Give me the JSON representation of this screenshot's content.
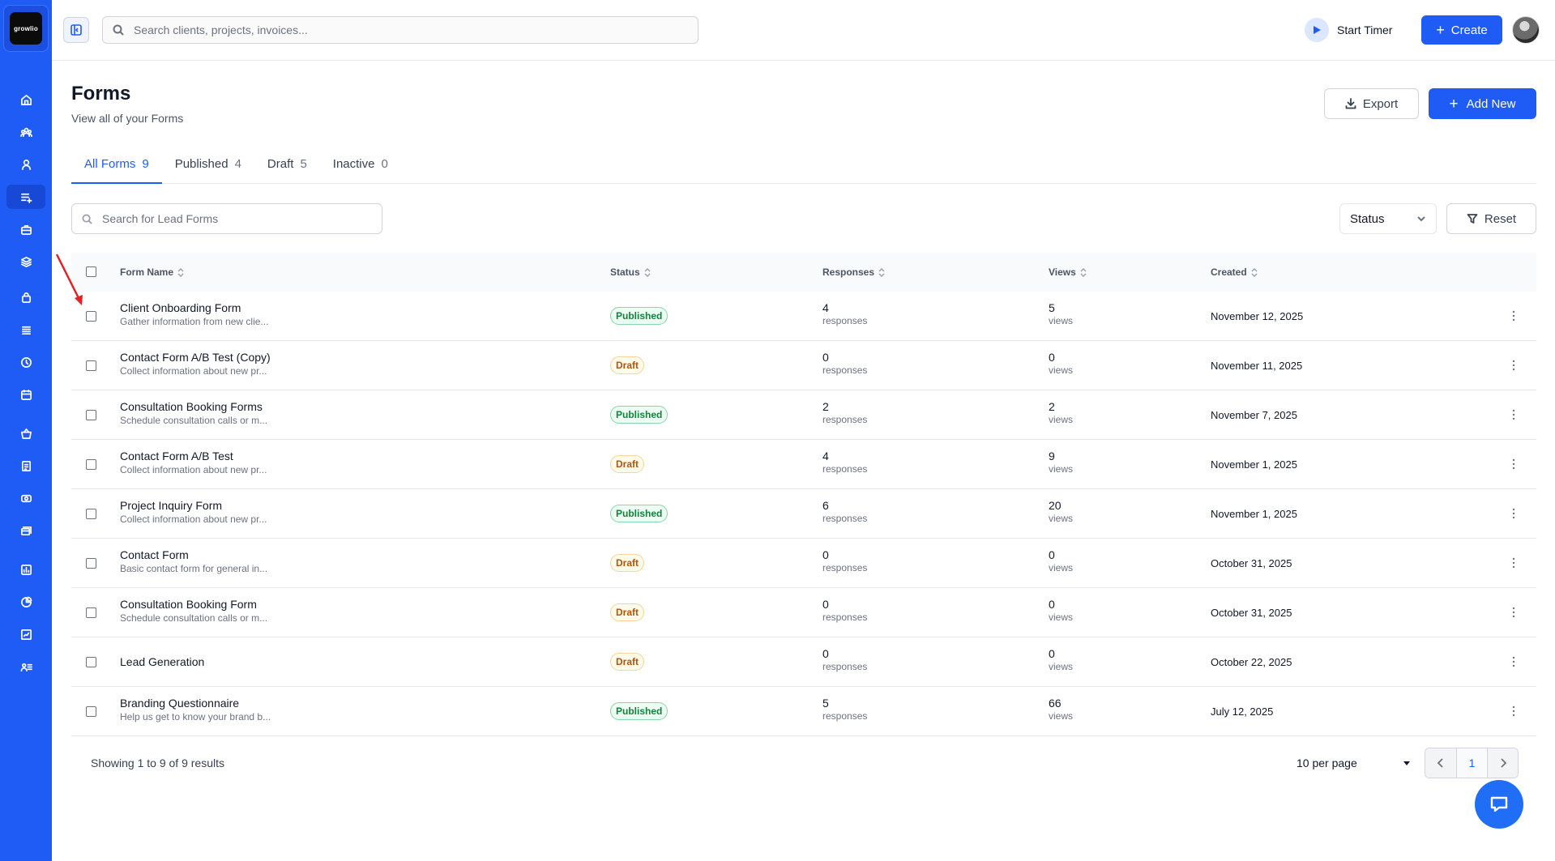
{
  "brand": {
    "logo_text": "growlio",
    "accent": "#1f5cf5"
  },
  "sidebar": {
    "items": [
      {
        "icon": "home-icon"
      },
      {
        "icon": "team-icon"
      },
      {
        "icon": "user-icon"
      },
      {
        "icon": "forms-icon",
        "active": true
      },
      {
        "icon": "briefcase-icon"
      },
      {
        "icon": "layers-icon"
      },
      {
        "icon": "bag-icon"
      },
      {
        "icon": "list-icon"
      },
      {
        "icon": "clock-icon"
      },
      {
        "icon": "calendar-icon"
      },
      {
        "icon": "basket-icon"
      },
      {
        "icon": "invoice-icon"
      },
      {
        "icon": "coins-icon"
      },
      {
        "icon": "cards-icon"
      },
      {
        "icon": "report-icon"
      },
      {
        "icon": "pie-chart-icon"
      },
      {
        "icon": "chart-box-icon"
      },
      {
        "icon": "user-list-icon"
      }
    ]
  },
  "topbar": {
    "search_placeholder": "Search clients, projects, invoices...",
    "start_timer_label": "Start Timer",
    "create_label": "Create"
  },
  "header": {
    "title": "Forms",
    "subtitle": "View all of your Forms",
    "export_label": "Export",
    "add_new_label": "Add New"
  },
  "tabs": [
    {
      "label": "All Forms",
      "count": "9",
      "active": true
    },
    {
      "label": "Published",
      "count": "4"
    },
    {
      "label": "Draft",
      "count": "5"
    },
    {
      "label": "Inactive",
      "count": "0"
    }
  ],
  "filters": {
    "search_placeholder": "Search for Lead Forms",
    "status_label": "Status",
    "reset_label": "Reset"
  },
  "table": {
    "columns": {
      "name": "Form Name",
      "status": "Status",
      "responses": "Responses",
      "views": "Views",
      "created": "Created"
    },
    "response_unit": "responses",
    "view_unit": "views",
    "rows": [
      {
        "name": "Client Onboarding Form",
        "desc": "Gather information from new clie...",
        "status": "Published",
        "responses": "4",
        "views": "5",
        "created": "November 12, 2025"
      },
      {
        "name": "Contact Form A/B Test (Copy)",
        "desc": "Collect information about new pr...",
        "status": "Draft",
        "responses": "0",
        "views": "0",
        "created": "November 11, 2025"
      },
      {
        "name": "Consultation Booking Forms",
        "desc": "Schedule consultation calls or m...",
        "status": "Published",
        "responses": "2",
        "views": "2",
        "created": "November 7, 2025"
      },
      {
        "name": "Contact Form A/B Test",
        "desc": "Collect information about new pr...",
        "status": "Draft",
        "responses": "4",
        "views": "9",
        "created": "November 1, 2025"
      },
      {
        "name": "Project Inquiry Form",
        "desc": "Collect information about new pr...",
        "status": "Published",
        "responses": "6",
        "views": "20",
        "created": "November 1, 2025"
      },
      {
        "name": "Contact Form",
        "desc": "Basic contact form for general in...",
        "status": "Draft",
        "responses": "0",
        "views": "0",
        "created": "October 31, 2025"
      },
      {
        "name": "Consultation Booking Form",
        "desc": "Schedule consultation calls or m...",
        "status": "Draft",
        "responses": "0",
        "views": "0",
        "created": "October 31, 2025"
      },
      {
        "name": "Lead Generation",
        "desc": "",
        "status": "Draft",
        "responses": "0",
        "views": "0",
        "created": "October 22, 2025"
      },
      {
        "name": "Branding Questionnaire",
        "desc": "Help us get to know your brand b...",
        "status": "Published",
        "responses": "5",
        "views": "66",
        "created": "July 12, 2025"
      }
    ]
  },
  "footer": {
    "showing_text": "Showing 1 to 9 of 9 results",
    "per_page_label": "10 per page",
    "current_page": "1"
  }
}
